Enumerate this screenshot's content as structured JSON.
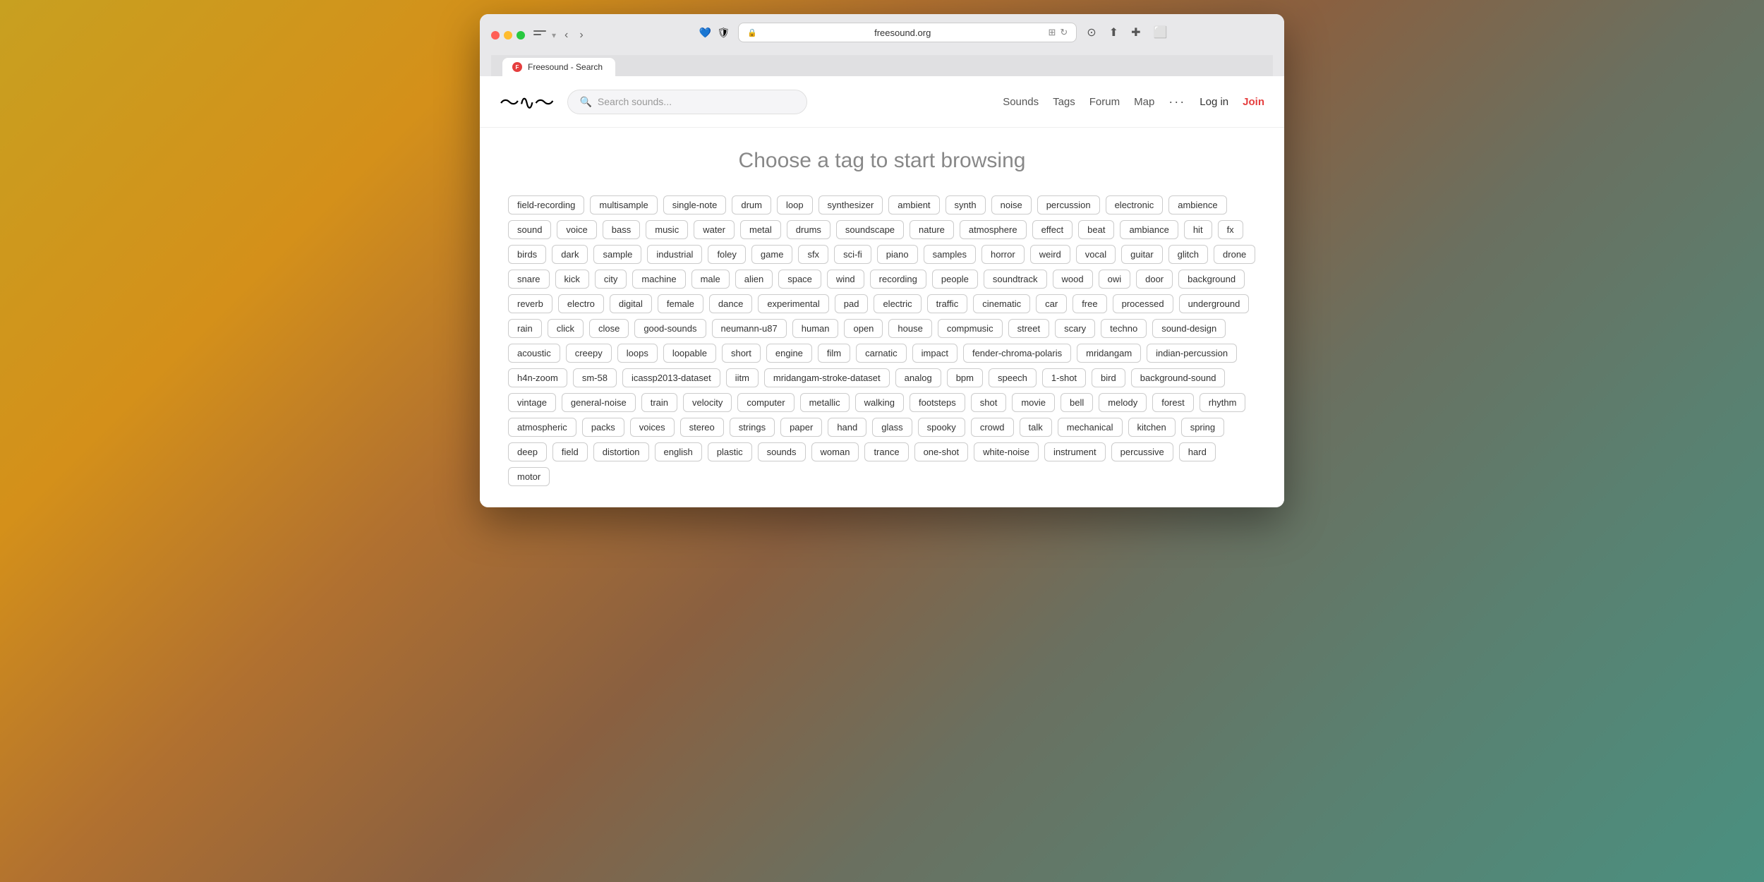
{
  "browser": {
    "address": "freesound.org",
    "tab_title": "Freesound - Search",
    "tab_favicon": "F"
  },
  "site": {
    "logo_text": "≋",
    "search_placeholder": "Search sounds...",
    "nav": {
      "sounds": "Sounds",
      "tags": "Tags",
      "forum": "Forum",
      "map": "Map",
      "more": "···",
      "login": "Log in",
      "join": "Join"
    },
    "page_title": "Choose a tag to start browsing"
  },
  "tags": [
    "field-recording",
    "multisample",
    "single-note",
    "drum",
    "loop",
    "synthesizer",
    "ambient",
    "synth",
    "noise",
    "percussion",
    "electronic",
    "ambience",
    "sound",
    "voice",
    "bass",
    "music",
    "water",
    "metal",
    "drums",
    "soundscape",
    "nature",
    "atmosphere",
    "effect",
    "beat",
    "ambiance",
    "hit",
    "fx",
    "birds",
    "dark",
    "sample",
    "industrial",
    "foley",
    "game",
    "sfx",
    "sci-fi",
    "piano",
    "samples",
    "horror",
    "weird",
    "vocal",
    "guitar",
    "glitch",
    "drone",
    "snare",
    "kick",
    "city",
    "machine",
    "male",
    "alien",
    "space",
    "wind",
    "recording",
    "people",
    "soundtrack",
    "wood",
    "owi",
    "door",
    "background",
    "reverb",
    "electro",
    "digital",
    "female",
    "dance",
    "experimental",
    "pad",
    "electric",
    "traffic",
    "cinematic",
    "car",
    "free",
    "processed",
    "underground",
    "rain",
    "click",
    "close",
    "good-sounds",
    "neumann-u87",
    "human",
    "open",
    "house",
    "compmusic",
    "street",
    "scary",
    "techno",
    "sound-design",
    "acoustic",
    "creepy",
    "loops",
    "loopable",
    "short",
    "engine",
    "film",
    "carnatic",
    "impact",
    "fender-chroma-polaris",
    "mridangam",
    "indian-percussion",
    "h4n-zoom",
    "sm-58",
    "icassp2013-dataset",
    "iitm",
    "mridangam-stroke-dataset",
    "analog",
    "bpm",
    "speech",
    "1-shot",
    "bird",
    "background-sound",
    "vintage",
    "general-noise",
    "train",
    "velocity",
    "computer",
    "metallic",
    "walking",
    "footsteps",
    "shot",
    "movie",
    "bell",
    "melody",
    "forest",
    "rhythm",
    "atmospheric",
    "packs",
    "voices",
    "stereo",
    "strings",
    "paper",
    "hand",
    "glass",
    "spooky",
    "crowd",
    "talk",
    "mechanical",
    "kitchen",
    "spring",
    "deep",
    "field",
    "distortion",
    "english",
    "plastic",
    "sounds",
    "woman",
    "trance",
    "one-shot",
    "white-noise",
    "instrument",
    "percussive",
    "hard",
    "motor"
  ]
}
